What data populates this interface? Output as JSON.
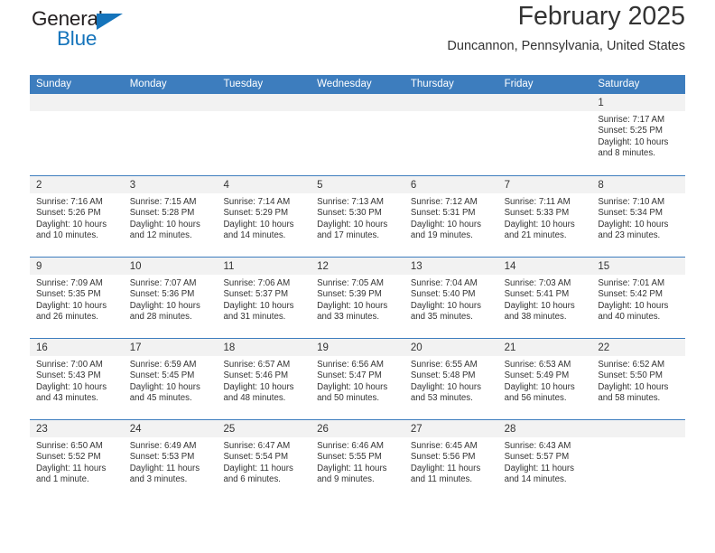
{
  "brand": {
    "name_top": "General",
    "name_bottom": "Blue"
  },
  "header": {
    "title": "February 2025",
    "location": "Duncannon, Pennsylvania, United States",
    "accent_color": "#3d7dbe"
  },
  "weekdays": [
    "Sunday",
    "Monday",
    "Tuesday",
    "Wednesday",
    "Thursday",
    "Friday",
    "Saturday"
  ],
  "weeks": [
    [
      {
        "day": "",
        "sunrise": "",
        "sunset": "",
        "daylight": "",
        "empty": true
      },
      {
        "day": "",
        "sunrise": "",
        "sunset": "",
        "daylight": "",
        "empty": true
      },
      {
        "day": "",
        "sunrise": "",
        "sunset": "",
        "daylight": "",
        "empty": true
      },
      {
        "day": "",
        "sunrise": "",
        "sunset": "",
        "daylight": "",
        "empty": true
      },
      {
        "day": "",
        "sunrise": "",
        "sunset": "",
        "daylight": "",
        "empty": true
      },
      {
        "day": "",
        "sunrise": "",
        "sunset": "",
        "daylight": "",
        "empty": true
      },
      {
        "day": "1",
        "sunrise": "Sunrise: 7:17 AM",
        "sunset": "Sunset: 5:25 PM",
        "daylight": "Daylight: 10 hours and 8 minutes.",
        "empty": false
      }
    ],
    [
      {
        "day": "2",
        "sunrise": "Sunrise: 7:16 AM",
        "sunset": "Sunset: 5:26 PM",
        "daylight": "Daylight: 10 hours and 10 minutes.",
        "empty": false
      },
      {
        "day": "3",
        "sunrise": "Sunrise: 7:15 AM",
        "sunset": "Sunset: 5:28 PM",
        "daylight": "Daylight: 10 hours and 12 minutes.",
        "empty": false
      },
      {
        "day": "4",
        "sunrise": "Sunrise: 7:14 AM",
        "sunset": "Sunset: 5:29 PM",
        "daylight": "Daylight: 10 hours and 14 minutes.",
        "empty": false
      },
      {
        "day": "5",
        "sunrise": "Sunrise: 7:13 AM",
        "sunset": "Sunset: 5:30 PM",
        "daylight": "Daylight: 10 hours and 17 minutes.",
        "empty": false
      },
      {
        "day": "6",
        "sunrise": "Sunrise: 7:12 AM",
        "sunset": "Sunset: 5:31 PM",
        "daylight": "Daylight: 10 hours and 19 minutes.",
        "empty": false
      },
      {
        "day": "7",
        "sunrise": "Sunrise: 7:11 AM",
        "sunset": "Sunset: 5:33 PM",
        "daylight": "Daylight: 10 hours and 21 minutes.",
        "empty": false
      },
      {
        "day": "8",
        "sunrise": "Sunrise: 7:10 AM",
        "sunset": "Sunset: 5:34 PM",
        "daylight": "Daylight: 10 hours and 23 minutes.",
        "empty": false
      }
    ],
    [
      {
        "day": "9",
        "sunrise": "Sunrise: 7:09 AM",
        "sunset": "Sunset: 5:35 PM",
        "daylight": "Daylight: 10 hours and 26 minutes.",
        "empty": false
      },
      {
        "day": "10",
        "sunrise": "Sunrise: 7:07 AM",
        "sunset": "Sunset: 5:36 PM",
        "daylight": "Daylight: 10 hours and 28 minutes.",
        "empty": false
      },
      {
        "day": "11",
        "sunrise": "Sunrise: 7:06 AM",
        "sunset": "Sunset: 5:37 PM",
        "daylight": "Daylight: 10 hours and 31 minutes.",
        "empty": false
      },
      {
        "day": "12",
        "sunrise": "Sunrise: 7:05 AM",
        "sunset": "Sunset: 5:39 PM",
        "daylight": "Daylight: 10 hours and 33 minutes.",
        "empty": false
      },
      {
        "day": "13",
        "sunrise": "Sunrise: 7:04 AM",
        "sunset": "Sunset: 5:40 PM",
        "daylight": "Daylight: 10 hours and 35 minutes.",
        "empty": false
      },
      {
        "day": "14",
        "sunrise": "Sunrise: 7:03 AM",
        "sunset": "Sunset: 5:41 PM",
        "daylight": "Daylight: 10 hours and 38 minutes.",
        "empty": false
      },
      {
        "day": "15",
        "sunrise": "Sunrise: 7:01 AM",
        "sunset": "Sunset: 5:42 PM",
        "daylight": "Daylight: 10 hours and 40 minutes.",
        "empty": false
      }
    ],
    [
      {
        "day": "16",
        "sunrise": "Sunrise: 7:00 AM",
        "sunset": "Sunset: 5:43 PM",
        "daylight": "Daylight: 10 hours and 43 minutes.",
        "empty": false
      },
      {
        "day": "17",
        "sunrise": "Sunrise: 6:59 AM",
        "sunset": "Sunset: 5:45 PM",
        "daylight": "Daylight: 10 hours and 45 minutes.",
        "empty": false
      },
      {
        "day": "18",
        "sunrise": "Sunrise: 6:57 AM",
        "sunset": "Sunset: 5:46 PM",
        "daylight": "Daylight: 10 hours and 48 minutes.",
        "empty": false
      },
      {
        "day": "19",
        "sunrise": "Sunrise: 6:56 AM",
        "sunset": "Sunset: 5:47 PM",
        "daylight": "Daylight: 10 hours and 50 minutes.",
        "empty": false
      },
      {
        "day": "20",
        "sunrise": "Sunrise: 6:55 AM",
        "sunset": "Sunset: 5:48 PM",
        "daylight": "Daylight: 10 hours and 53 minutes.",
        "empty": false
      },
      {
        "day": "21",
        "sunrise": "Sunrise: 6:53 AM",
        "sunset": "Sunset: 5:49 PM",
        "daylight": "Daylight: 10 hours and 56 minutes.",
        "empty": false
      },
      {
        "day": "22",
        "sunrise": "Sunrise: 6:52 AM",
        "sunset": "Sunset: 5:50 PM",
        "daylight": "Daylight: 10 hours and 58 minutes.",
        "empty": false
      }
    ],
    [
      {
        "day": "23",
        "sunrise": "Sunrise: 6:50 AM",
        "sunset": "Sunset: 5:52 PM",
        "daylight": "Daylight: 11 hours and 1 minute.",
        "empty": false
      },
      {
        "day": "24",
        "sunrise": "Sunrise: 6:49 AM",
        "sunset": "Sunset: 5:53 PM",
        "daylight": "Daylight: 11 hours and 3 minutes.",
        "empty": false
      },
      {
        "day": "25",
        "sunrise": "Sunrise: 6:47 AM",
        "sunset": "Sunset: 5:54 PM",
        "daylight": "Daylight: 11 hours and 6 minutes.",
        "empty": false
      },
      {
        "day": "26",
        "sunrise": "Sunrise: 6:46 AM",
        "sunset": "Sunset: 5:55 PM",
        "daylight": "Daylight: 11 hours and 9 minutes.",
        "empty": false
      },
      {
        "day": "27",
        "sunrise": "Sunrise: 6:45 AM",
        "sunset": "Sunset: 5:56 PM",
        "daylight": "Daylight: 11 hours and 11 minutes.",
        "empty": false
      },
      {
        "day": "28",
        "sunrise": "Sunrise: 6:43 AM",
        "sunset": "Sunset: 5:57 PM",
        "daylight": "Daylight: 11 hours and 14 minutes.",
        "empty": false
      },
      {
        "day": "",
        "sunrise": "",
        "sunset": "",
        "daylight": "",
        "empty": true
      }
    ]
  ]
}
